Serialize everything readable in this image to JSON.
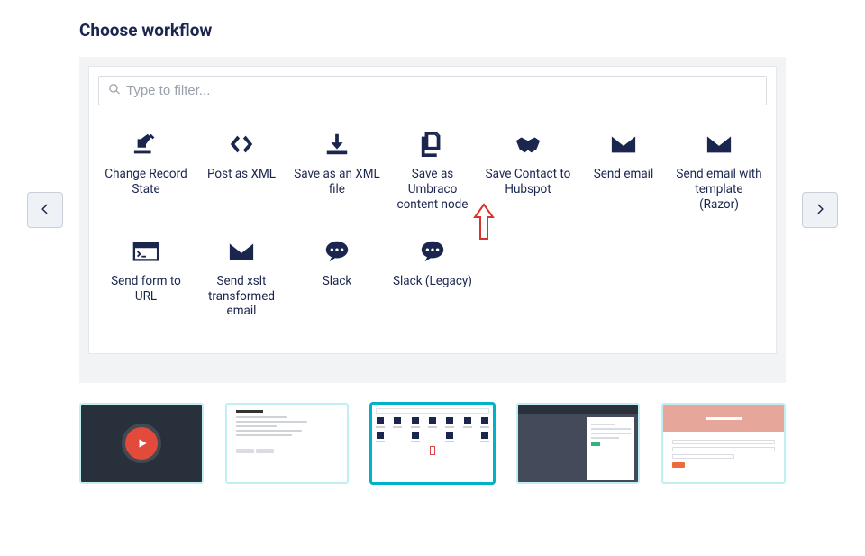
{
  "title": "Choose workflow",
  "filter": {
    "placeholder": "Type to filter..."
  },
  "workflows": [
    {
      "label": "Change Record State",
      "icon": "edit-sheet-icon"
    },
    {
      "label": "Post as XML",
      "icon": "code-icon"
    },
    {
      "label": "Save as an XML file",
      "icon": "download-icon"
    },
    {
      "label": "Save as Umbraco content node",
      "icon": "documents-icon"
    },
    {
      "label": "Save Contact to Hubspot",
      "icon": "handshake-icon"
    },
    {
      "label": "Send email",
      "icon": "envelope-icon"
    },
    {
      "label": "Send email with template (Razor)",
      "icon": "envelope-icon"
    },
    {
      "label": "Send form to URL",
      "icon": "terminal-window-icon"
    },
    {
      "label": "Send xslt transformed email",
      "icon": "envelope-icon"
    },
    {
      "label": "Slack",
      "icon": "speech-bubble-icon"
    },
    {
      "label": "Slack (Legacy)",
      "icon": "speech-bubble-icon"
    }
  ],
  "gallery": {
    "thumbnails": [
      {
        "kind": "video",
        "active": false
      },
      {
        "kind": "form-ui",
        "active": false
      },
      {
        "kind": "workflow-grid",
        "active": true
      },
      {
        "kind": "dark-dialog",
        "active": false
      },
      {
        "kind": "pink-form",
        "active": false
      }
    ]
  },
  "colors": {
    "ink": "#1b264f",
    "accent": "#00b2c8",
    "annotation": "#d9332b"
  }
}
